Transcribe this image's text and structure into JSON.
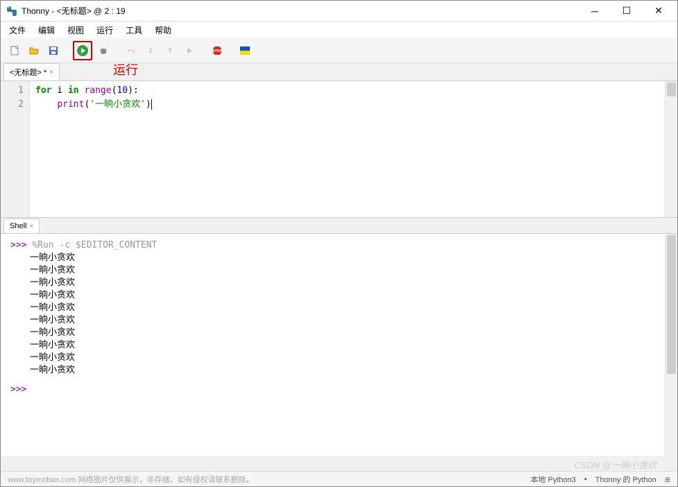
{
  "window": {
    "title": "Thonny  -  <无标题>  @  2 : 19"
  },
  "menu": {
    "file": "文件",
    "edit": "编辑",
    "view": "视图",
    "run": "运行",
    "tools": "工具",
    "help": "帮助"
  },
  "annotation": {
    "run_label": "运行"
  },
  "editor": {
    "tab_label": "<无标题> *",
    "lines": [
      "1",
      "2"
    ],
    "code": {
      "line1": {
        "kw1": "for",
        "var": " i ",
        "kw2": "in",
        "sp": " ",
        "func": "range",
        "lp": "(",
        "num": "10",
        "rp": "):"
      },
      "line2": {
        "indent": "    ",
        "func": "print",
        "lp": "(",
        "str": "'一晌小贪欢'",
        "rp": ")"
      }
    }
  },
  "shell": {
    "tab_label": "Shell",
    "prompt": ">>> ",
    "run_cmd": "%Run -c $EDITOR_CONTENT",
    "output_line": "一晌小贪欢",
    "output_count": 10
  },
  "statusbar": {
    "footer_text": "www.toymoban.com  网络图片仅供展示，非存储，如有侵权请联系删除。",
    "python_label": "本地 Python3",
    "thonny_label": "Thonny 的 Python"
  },
  "watermark": {
    "text": "CSDN @一晌小贪欢"
  }
}
